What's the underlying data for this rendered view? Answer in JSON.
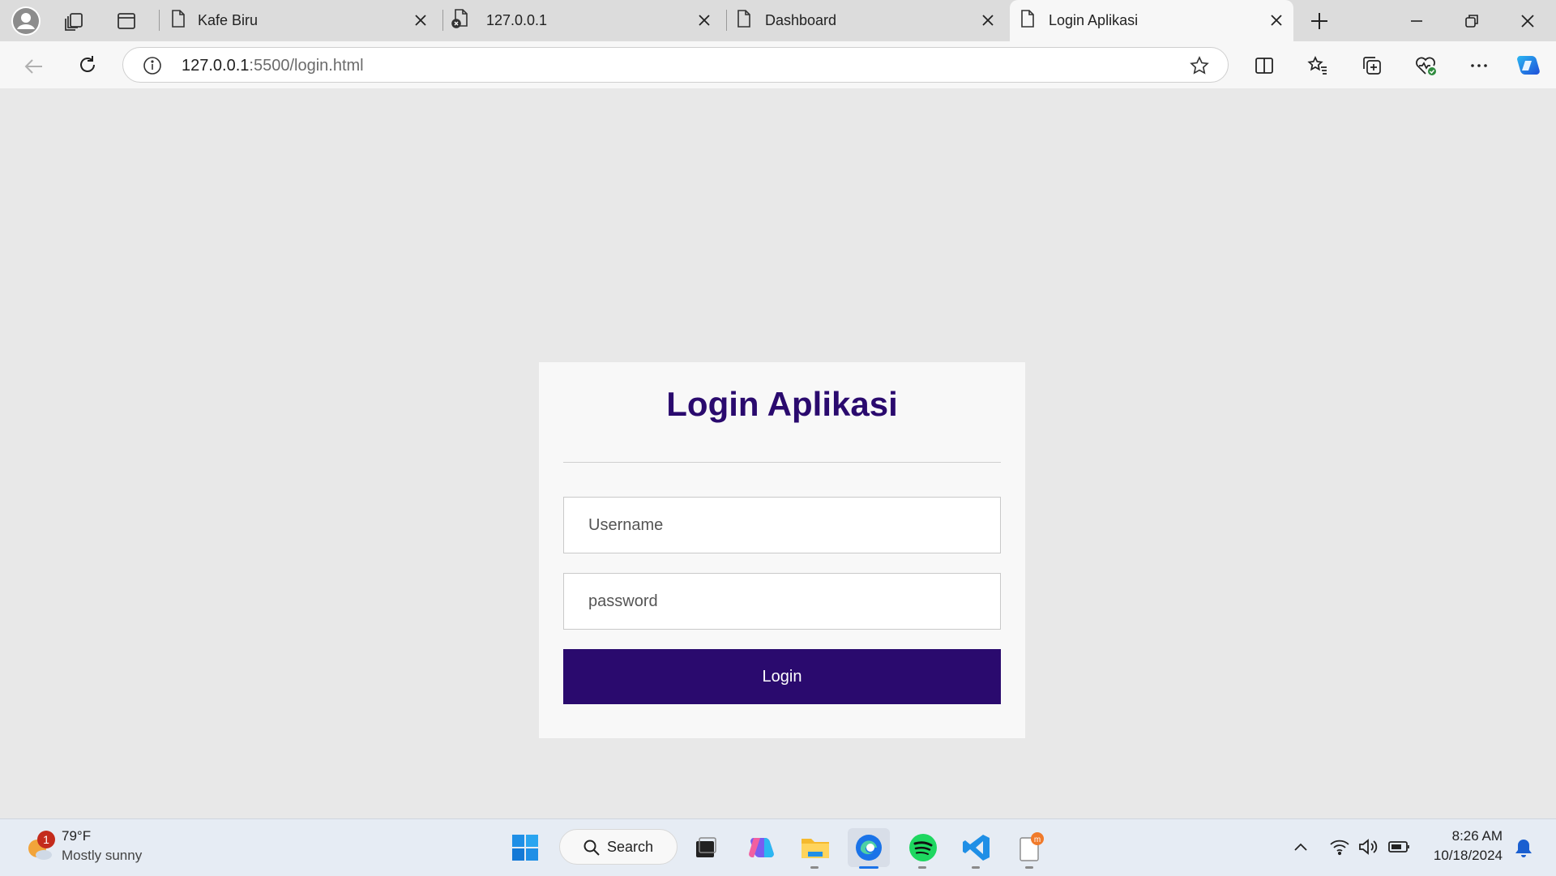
{
  "browser": {
    "tabs": [
      {
        "title": "Kafe Biru"
      },
      {
        "title": "127.0.0.1"
      },
      {
        "title": "Dashboard"
      },
      {
        "title": "Login Aplikasi"
      }
    ],
    "url_host": "127.0.0.1",
    "url_path": ":5500/login.html"
  },
  "login": {
    "title": "Login Aplikasi",
    "username_placeholder": "Username",
    "password_placeholder": "password",
    "button_label": "Login"
  },
  "taskbar": {
    "weather_temp": "79°F",
    "weather_desc": "Mostly sunny",
    "weather_badge": "1",
    "search_label": "Search",
    "time": "8:26 AM",
    "date": "10/18/2024"
  },
  "colors": {
    "accent": "#2a0a6e",
    "edge_blue": "#1a73e8"
  }
}
